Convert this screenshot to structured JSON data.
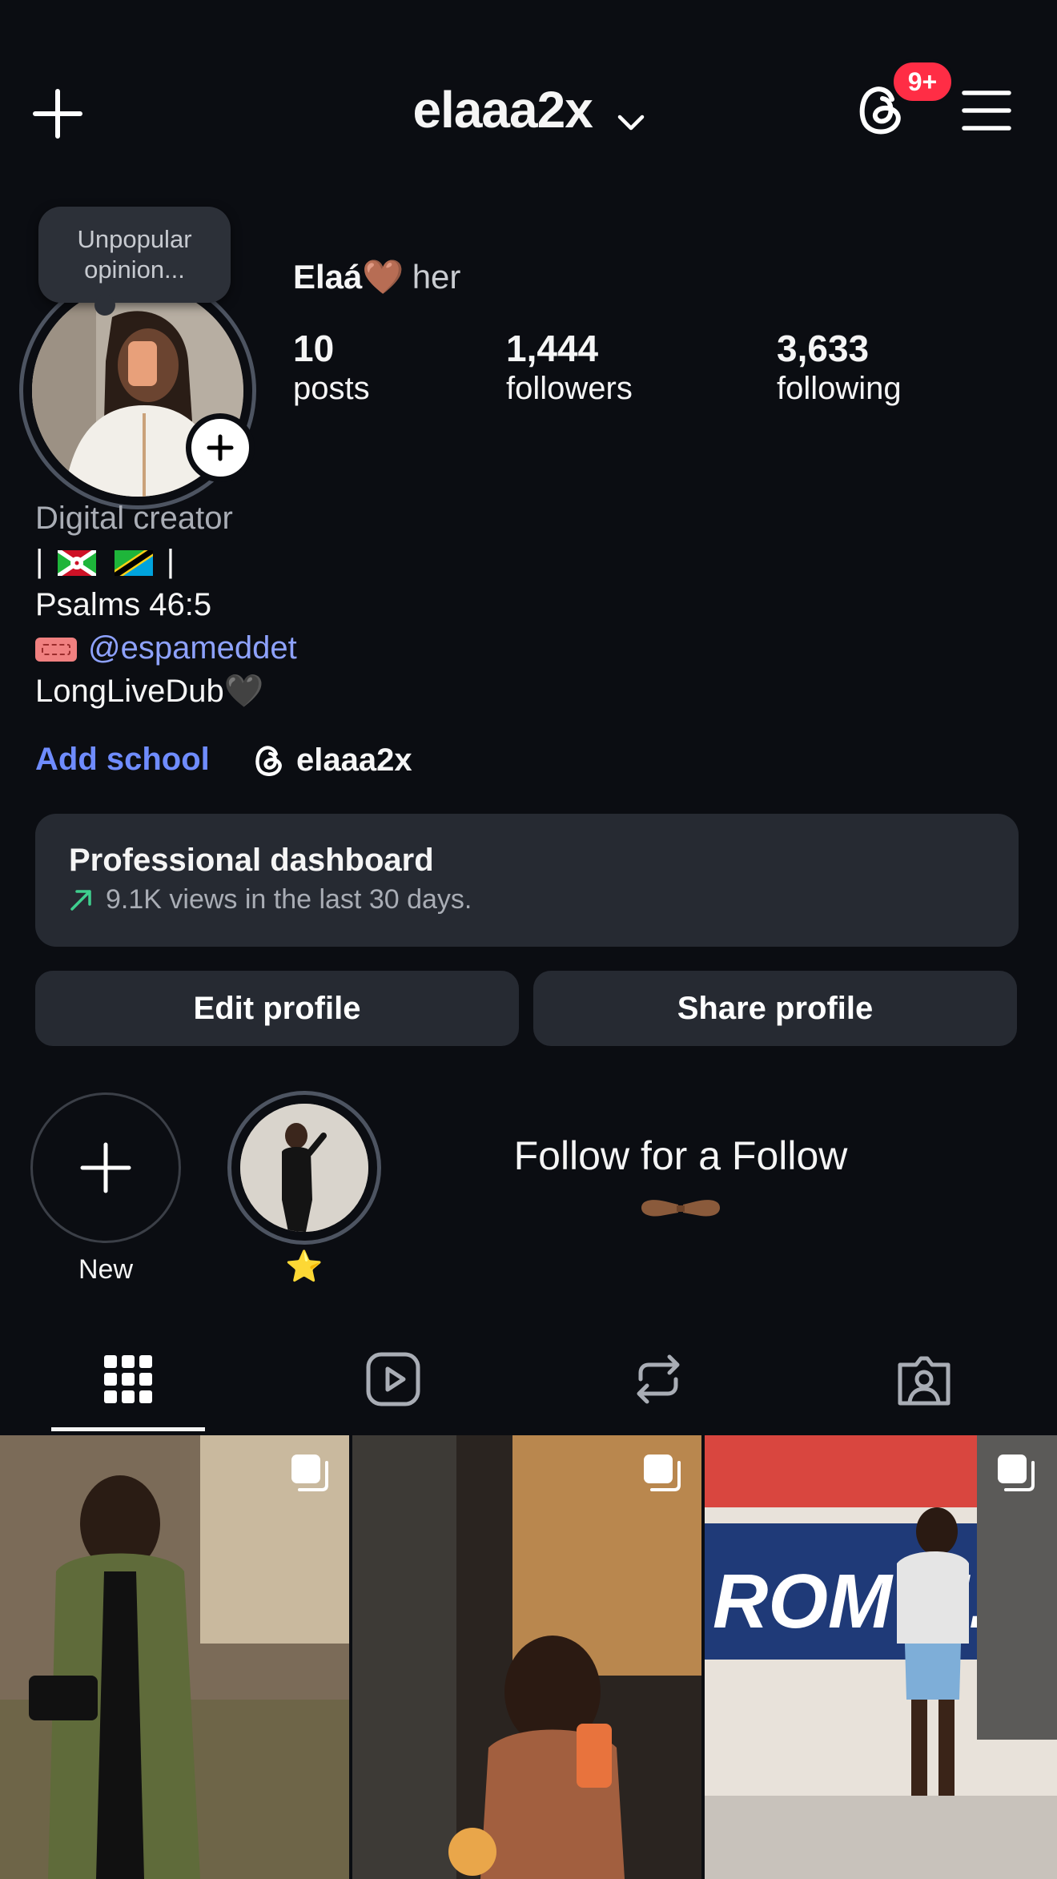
{
  "header": {
    "username": "elaaa2x",
    "notification_badge": "9+",
    "accent_badge_color": "#ff2d45"
  },
  "profile": {
    "note": "Unpopular opinion...",
    "display_name": "Elaá🤎",
    "pronouns": "her",
    "stats": [
      {
        "value": "10",
        "label": "posts"
      },
      {
        "value": "1,444",
        "label": "followers"
      },
      {
        "value": "3,633",
        "label": "following"
      }
    ]
  },
  "bio": {
    "category": "Digital creator",
    "flags_line_start": "|",
    "flags_line_end": "|",
    "verse": "Psalms 46:5",
    "mention": "@espameddet",
    "tagline": "LongLiveDub🖤",
    "link_color": "#8ea2ff"
  },
  "links": {
    "add_school": "Add school",
    "threads_handle": "elaaa2x"
  },
  "dashboard": {
    "title": "Professional dashboard",
    "subtitle": "9.1K views in the last 30 days."
  },
  "actions": {
    "edit_profile": "Edit profile",
    "share_profile": "Share profile"
  },
  "highlights": {
    "new_label": "New",
    "star_label": "⭐",
    "overlay_text": "Follow for a Follow",
    "overlay_emoji": "🫱🏾‍🫲🏾"
  },
  "tabs": [
    "grid-icon",
    "reels-icon",
    "reposts-icon",
    "tagged-icon"
  ]
}
